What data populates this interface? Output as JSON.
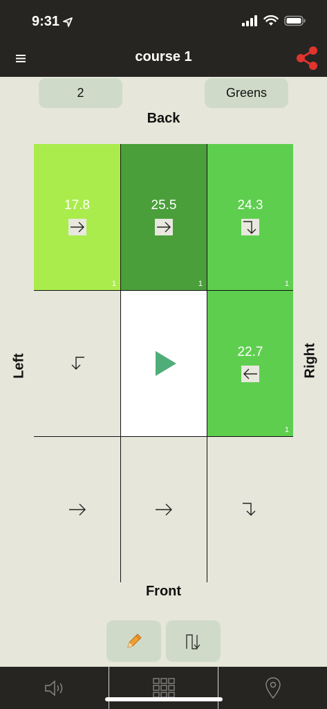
{
  "status": {
    "time": "9:31"
  },
  "header": {
    "title": "course 1"
  },
  "pills": {
    "left": "2",
    "right": "Greens"
  },
  "sides": {
    "back": "Back",
    "front": "Front",
    "left": "Left",
    "right": "Right"
  },
  "grid": {
    "r0c0": {
      "value": "17.8",
      "count": "1",
      "arrow": "arrow-right",
      "color": "#aaec4c"
    },
    "r0c1": {
      "value": "25.5",
      "count": "1",
      "arrow": "arrow-right",
      "color": "#4a9f3b"
    },
    "r0c2": {
      "value": "24.3",
      "count": "1",
      "arrow": "arrow-right-down",
      "color": "#5ece4f"
    },
    "r1c0": {
      "arrow": "arrow-left-down"
    },
    "r1c1": {
      "icon": "play-icon",
      "color": "#ffffff"
    },
    "r1c2": {
      "value": "22.7",
      "count": "1",
      "arrow": "arrow-left",
      "color": "#5ece4f"
    },
    "r2c0": {
      "arrow": "arrow-right"
    },
    "r2c1": {
      "arrow": "arrow-right"
    },
    "r2c2": {
      "arrow": "arrow-right-down"
    }
  },
  "tools": {
    "edit": "pencil-icon",
    "route": "route-icon"
  },
  "tabs": {
    "sound": "speaker-icon",
    "grid": "grid-icon",
    "map": "map-pin-icon"
  },
  "colors": {
    "header": "#262521",
    "background": "#e6e6da",
    "pill": "#cfdbc8",
    "share": "#e0342f"
  }
}
